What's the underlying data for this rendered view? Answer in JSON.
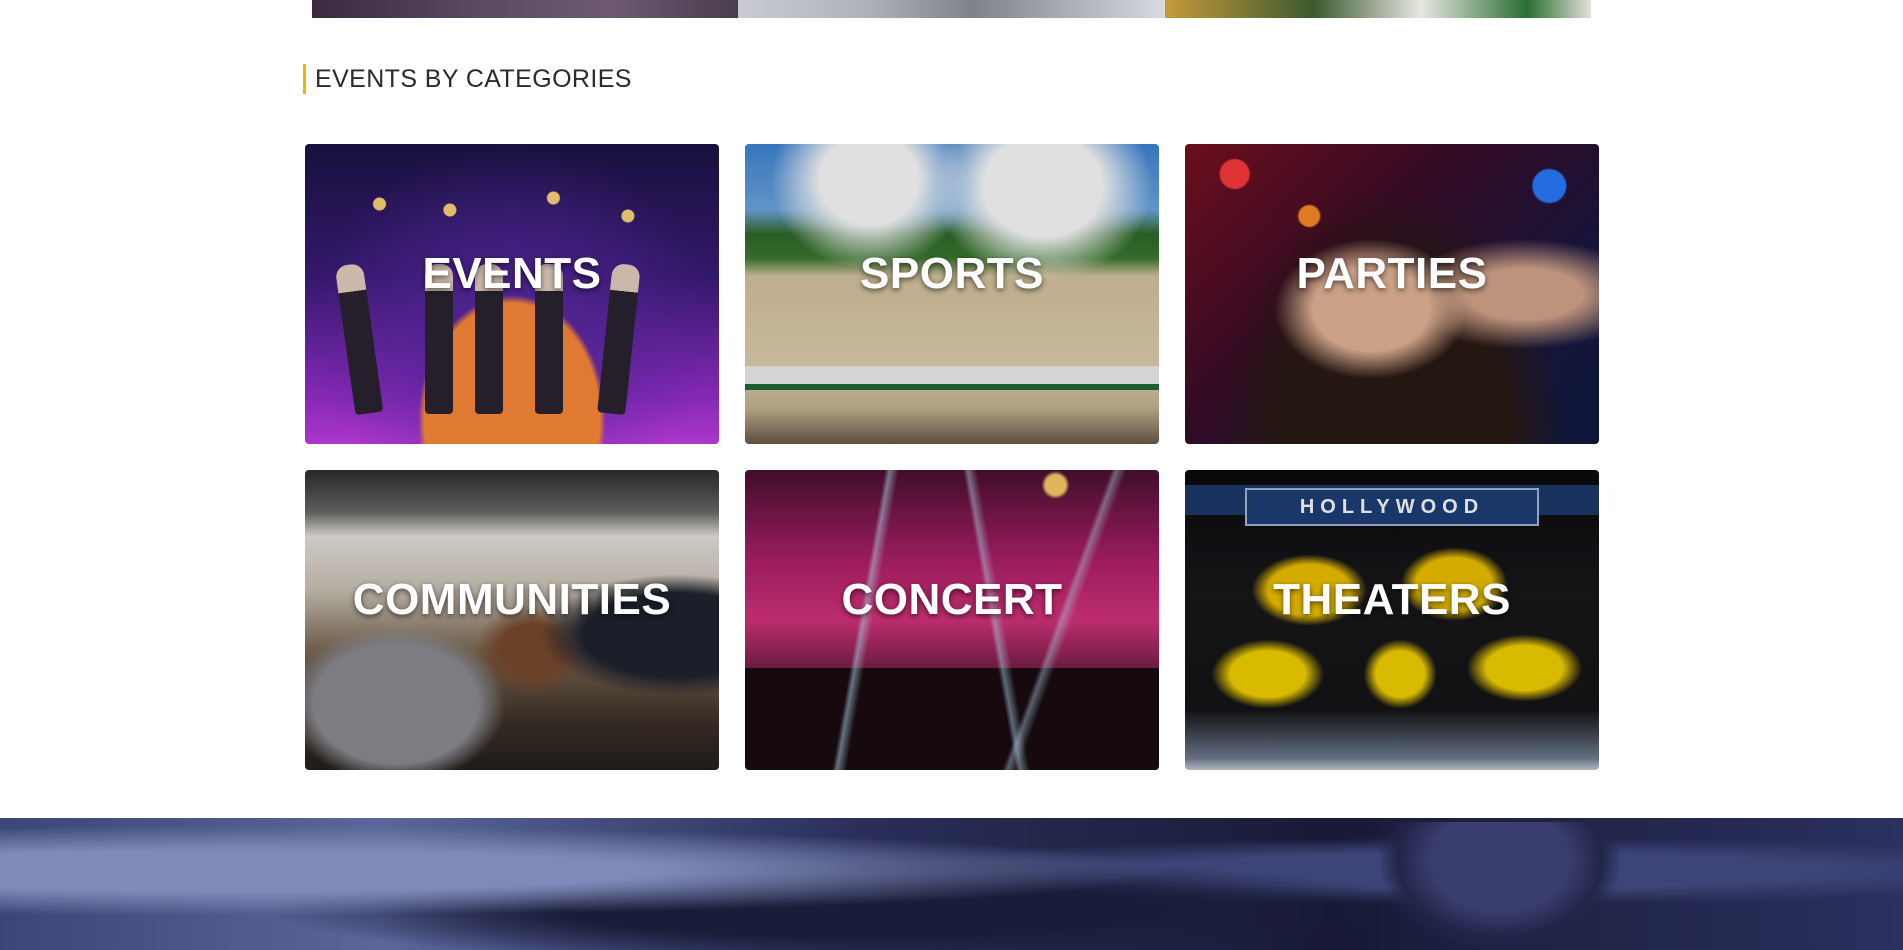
{
  "top_strip": {
    "images": [
      "previous-section-image-1",
      "previous-section-image-2",
      "previous-section-image-3"
    ]
  },
  "section": {
    "title": "EVENTS BY CATEGORIES",
    "accent_color": "#f5b400"
  },
  "categories": [
    {
      "label": "EVENTS"
    },
    {
      "label": "SPORTS"
    },
    {
      "label": "PARTIES"
    },
    {
      "label": "COMMUNITIES"
    },
    {
      "label": "CONCERT"
    },
    {
      "label": "THEATERS"
    }
  ],
  "theaters_image": {
    "sign_text": "HOLLYWOOD"
  }
}
